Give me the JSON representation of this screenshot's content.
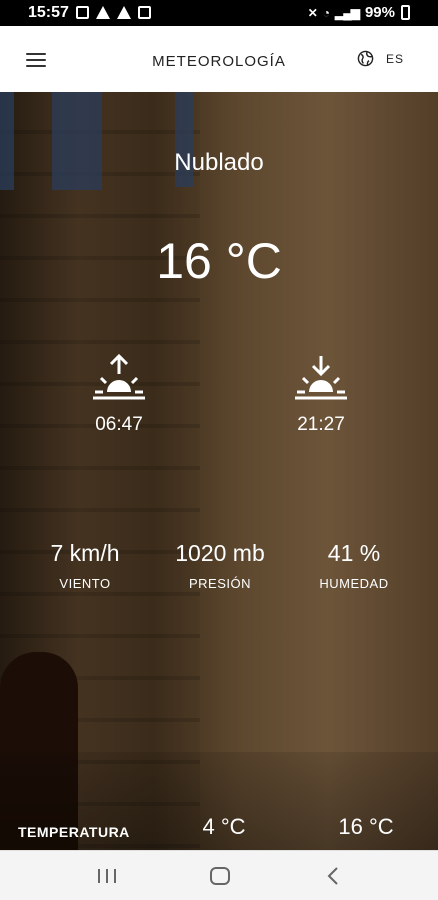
{
  "status_bar": {
    "time": "15:57",
    "battery": "99%"
  },
  "app_bar": {
    "title": "METEOROLOGÍA",
    "language": "ES"
  },
  "weather": {
    "condition": "Nublado",
    "temperature": "16 °C",
    "sunrise": "06:47",
    "sunset": "21:27",
    "wind": {
      "value": "7 km/h",
      "label": "VIENTO"
    },
    "pressure": {
      "value": "1020 mb",
      "label": "PRESIÓN"
    },
    "humidity": {
      "value": "41 %",
      "label": "HUMEDAD"
    }
  },
  "temperature_range": {
    "label": "TEMPERATURA",
    "min": "4 °C",
    "max": "16 °C"
  }
}
